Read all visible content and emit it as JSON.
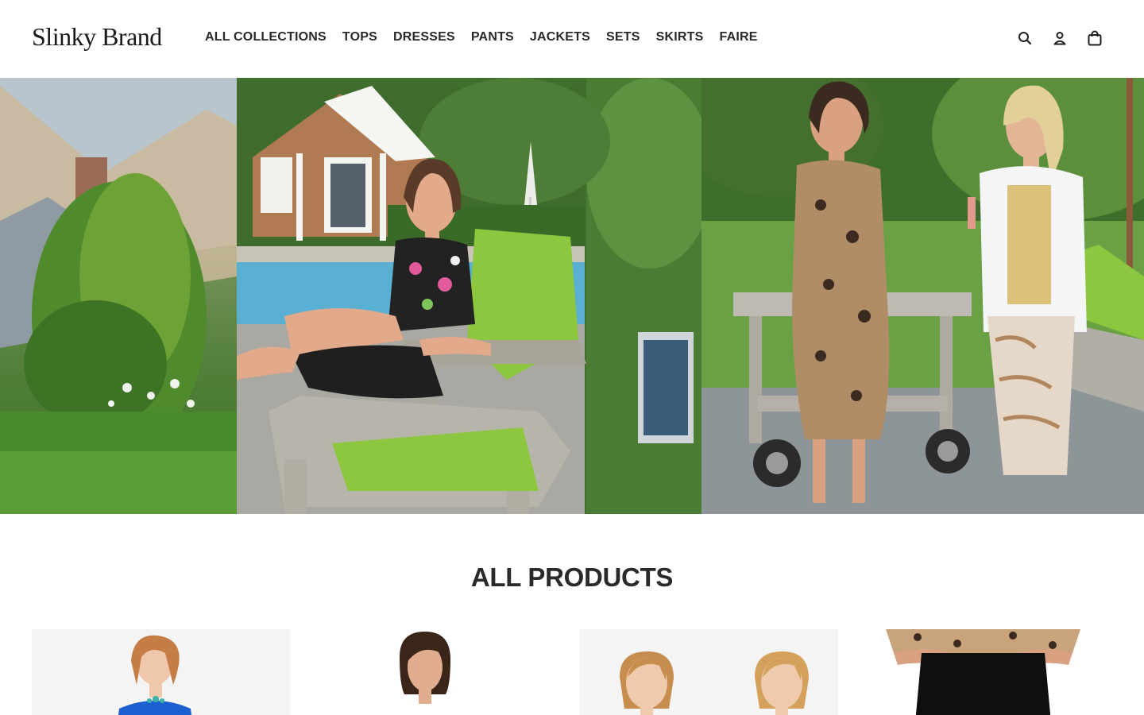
{
  "brand": {
    "logo_text": "Slinky Brand"
  },
  "nav": {
    "items": [
      {
        "label": "ALL COLLECTIONS"
      },
      {
        "label": "TOPS"
      },
      {
        "label": "DRESSES"
      },
      {
        "label": "PANTS"
      },
      {
        "label": "JACKETS"
      },
      {
        "label": "SETS"
      },
      {
        "label": "SKIRTS"
      },
      {
        "label": "FAIRE"
      }
    ]
  },
  "header_icons": [
    "search-icon",
    "account-icon",
    "cart-icon"
  ],
  "hero": {
    "panels": [
      "house-garden-photo",
      "woman-in-lime-chair-photo",
      "two-women-with-wine-photo"
    ]
  },
  "products": {
    "title": "ALL PRODUCTS",
    "cards": [
      {
        "image": "woman-blue-top-photo"
      },
      {
        "image": "woman-dark-hair-photo"
      },
      {
        "image": "two-women-photo"
      },
      {
        "image": "black-pants-leopard-top-photo"
      }
    ]
  },
  "colors": {
    "text": "#2a2a2a",
    "lime_cushion": "#8dc63f",
    "background": "#ffffff"
  }
}
